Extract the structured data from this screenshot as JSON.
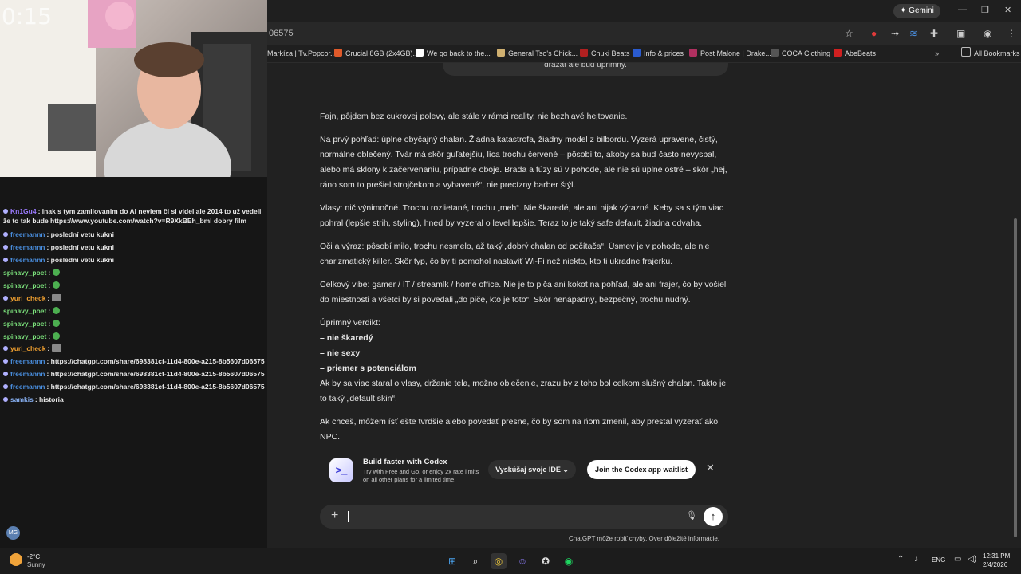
{
  "browser": {
    "url_fragment": "06575",
    "gemini_label": "Gemini",
    "bookmarks": [
      {
        "label": "Markíza | Tv.Popcor...",
        "color": "#3d7be0"
      },
      {
        "label": "Crucial 8GB (2x4GB)...",
        "color": "#e05a2a"
      },
      {
        "label": "We go back to the...",
        "color": "#ffffff"
      },
      {
        "label": "General Tso's Chick...",
        "color": "#d0b070"
      },
      {
        "label": "Chuki Beats",
        "color": "#b02020"
      },
      {
        "label": "Info & prices",
        "color": "#2a5bd0"
      },
      {
        "label": "Post Malone | Drake...",
        "color": "#b03060"
      },
      {
        "label": "COCA Clothing",
        "color": "#222222"
      },
      {
        "label": "AbeBeats",
        "color": "#d02020"
      }
    ],
    "all_bookmarks": "All Bookmarks"
  },
  "stream": {
    "timer": "0:15",
    "chat": [
      {
        "user": "Kn1Gu4",
        "user_color": "#9b7bff",
        "text": ": inak s tym zamilovanim do AI neviem či si videl ale 2014 to už vedeli že to tak bude https://www.youtube.com/watch?v=R9XkBEh_bml dobry film",
        "emote": ""
      },
      {
        "user": "freemannn",
        "user_color": "#4a90e2",
        "text": ": poslední vetu kukni",
        "emote": ""
      },
      {
        "user": "freemannn",
        "user_color": "#4a90e2",
        "text": ": poslední vetu kukni",
        "emote": ""
      },
      {
        "user": "freemannn",
        "user_color": "#4a90e2",
        "text": ": poslední vetu kukni",
        "emote": ""
      },
      {
        "user": "spinavy_poet",
        "user_color": "#7be07b",
        "text": ":",
        "emote": "green"
      },
      {
        "user": "spinavy_poet",
        "user_color": "#7be07b",
        "text": ":",
        "emote": "green"
      },
      {
        "user": "yuri_check",
        "user_color": "#f0a030",
        "text": ":",
        "emote": "gray"
      },
      {
        "user": "spinavy_poet",
        "user_color": "#7be07b",
        "text": ":",
        "emote": "green"
      },
      {
        "user": "spinavy_poet",
        "user_color": "#7be07b",
        "text": ":",
        "emote": "green"
      },
      {
        "user": "spinavy_poet",
        "user_color": "#7be07b",
        "text": ":",
        "emote": "green"
      },
      {
        "user": "yuri_check",
        "user_color": "#f0a030",
        "text": ":",
        "emote": "gray"
      },
      {
        "user": "freemannn",
        "user_color": "#4a90e2",
        "text": ": https://chatgpt.com/share/698381cf-11d4-800e-a215-8b5607d06575",
        "emote": ""
      },
      {
        "user": "freemannn",
        "user_color": "#4a90e2",
        "text": ": https://chatgpt.com/share/698381cf-11d4-800e-a215-8b5607d06575",
        "emote": ""
      },
      {
        "user": "freemannn",
        "user_color": "#4a90e2",
        "text": ": https://chatgpt.com/share/698381cf-11d4-800e-a215-8b5607d06575",
        "emote": ""
      },
      {
        "user": "samkis",
        "user_color": "#8ab4f8",
        "text": ": historia",
        "emote": ""
      }
    ],
    "avatar_initials": "MG"
  },
  "chatgpt": {
    "prev_bubble": "drazat ale bud uprimny.",
    "response": {
      "p1": "Fajn, pôjdem bez cukrovej polevy, ale stále v rámci reality, nie bezhlavé hejtovanie.",
      "p2": "Na prvý pohľad: úplne obyčajný chalan. Žiadna katastrofa, žiadny model z bilbordu. Vyzerá upravene, čistý, normálne oblečený. Tvár má skôr guľatejšiu, líca trochu červené – pôsobí to, akoby sa buď často nevyspal, alebo má sklony k začervenaniu, prípadne oboje. Brada a fúzy sú v pohode, ale nie sú úplne ostré – skôr „hej, ráno som to prešiel strojčekom a vybavené“, nie precízny barber štýl.",
      "p3": "Vlasy: nič výnimočné. Trochu rozlietané, trochu „meh“. Nie škaredé, ale ani nijak výrazné. Keby sa s tým viac pohral (lepšie strih, styling), hneď by vyzeral o level lepšie. Teraz to je taký safe default, žiadna odvaha.",
      "p4": "Oči a výraz: pôsobí milo, trochu nesmelo, až taký „dobrý chalan od počítača“. Úsmev je v pohode, ale nie charizmatický killer. Skôr typ, čo by ti pomohol nastaviť Wi-Fi než niekto, kto ti ukradne frajerku.",
      "p5": "Celkový vibe: gamer / IT / streamlk / home office. Nie je to piča ani kokot na pohľad, ale ani frajer, čo by vošiel do miestnosti a všetci by si povedali „do piče, kto je toto“. Skôr nenápadný, bezpečný, trochu nudný.",
      "verdict_title": "Úprimný verdikt:",
      "verdict_1": "– nie škaredý",
      "verdict_2": "– nie sexy",
      "verdict_3": "– priemer s potenciálom",
      "p6": "Ak by sa viac staral o vlasy, držanie tela, možno oblečenie, zrazu by z toho bol celkom slušný chalan. Takto je to taký „default skin“.",
      "p7": "Ak chceš, môžem ísť ešte tvrdšie alebo povedať presne, čo by som na ňom zmenil, aby prestal vyzerať ako NPC."
    },
    "banner": {
      "title": "Build faster with Codex",
      "subtitle": "Try with Free and Go, or enjoy 2x rate limits on all other plans for a limited time.",
      "ide_button": "Vyskúšaj svoje IDE",
      "join_button": "Join the Codex app waitlist"
    },
    "disclaimer": "ChatGPT môže robiť chyby. Over dôležité informácie."
  },
  "taskbar": {
    "temp": "-2°C",
    "weather": "Sunny",
    "lang": "ENG",
    "time": "12:31 PM",
    "date": "2/4/2026"
  }
}
